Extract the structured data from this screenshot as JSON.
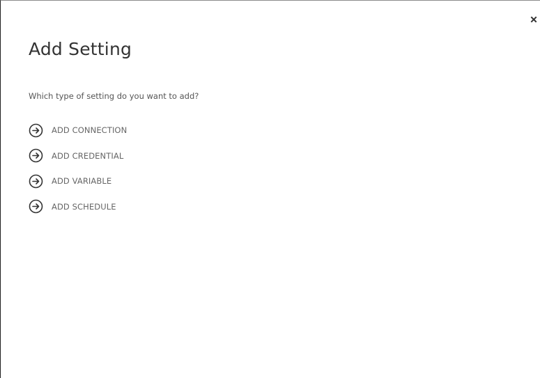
{
  "dialog": {
    "title": "Add Setting",
    "prompt": "Which type of setting do you want to add?",
    "close_icon": "close-icon",
    "options": [
      {
        "label": "ADD CONNECTION",
        "icon": "circle-arrow-right-icon"
      },
      {
        "label": "ADD CREDENTIAL",
        "icon": "circle-arrow-right-icon"
      },
      {
        "label": "ADD VARIABLE",
        "icon": "circle-arrow-right-icon"
      },
      {
        "label": "ADD SCHEDULE",
        "icon": "circle-arrow-right-icon"
      }
    ]
  },
  "colors": {
    "background": "#ffffff",
    "title_text": "#333333",
    "option_text": "#666666",
    "icon_stroke": "#333333"
  }
}
